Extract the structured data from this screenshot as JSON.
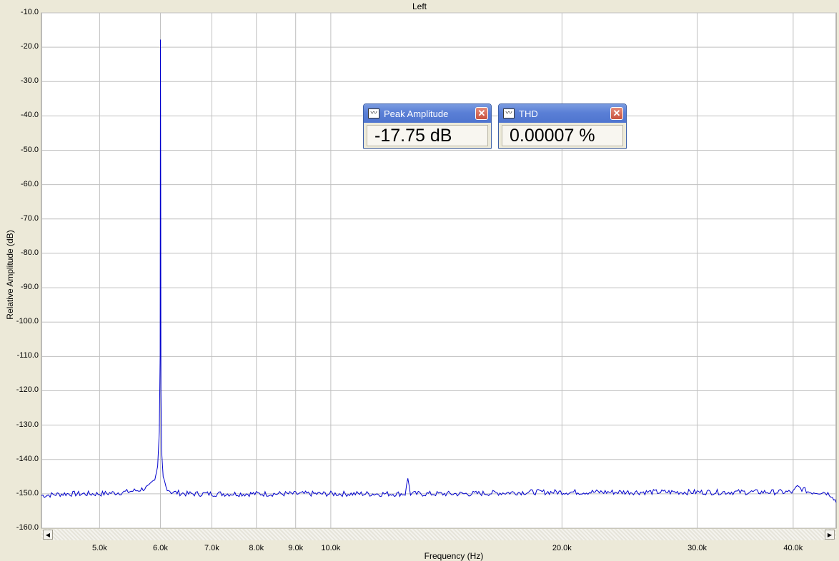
{
  "chart_data": {
    "type": "line",
    "title": "Left",
    "xlabel": "Frequency (Hz)",
    "ylabel": "Relative Amplitude (dB)",
    "x_scale": "log",
    "xlim": [
      4200,
      45500
    ],
    "ylim": [
      -160,
      -10
    ],
    "grid": true,
    "x_ticks": [
      5000,
      6000,
      7000,
      8000,
      9000,
      10000,
      20000,
      30000,
      40000
    ],
    "x_tick_labels": [
      "5.0k",
      "6.0k",
      "7.0k",
      "8.0k",
      "9.0k",
      "10.0k",
      "20.0k",
      "30.0k",
      "40.0k"
    ],
    "y_ticks": [
      -10,
      -20,
      -30,
      -40,
      -50,
      -60,
      -70,
      -80,
      -90,
      -100,
      -110,
      -120,
      -130,
      -140,
      -150,
      -160
    ],
    "y_tick_labels": [
      "-10.0",
      "-20.0",
      "-30.0",
      "-40.0",
      "-50.0",
      "-60.0",
      "-70.0",
      "-80.0",
      "-90.0",
      "-100.0",
      "-110.0",
      "-120.0",
      "-130.0",
      "-140.0",
      "-150.0",
      "-160.0"
    ],
    "series": [
      {
        "color": "#0000cc",
        "x": [
          4200,
          4500,
          5000,
          5400,
          5600,
          5800,
          5900,
          5950,
          5980,
          5995,
          6000,
          6005,
          6010,
          6020,
          6050,
          6100,
          6200,
          6500,
          7000,
          8000,
          9000,
          10000,
          11000,
          12000,
          12500,
          12600,
          12700,
          13000,
          15000,
          18000,
          20000,
          22000,
          25000,
          30000,
          35000,
          38000,
          40000,
          40500,
          42000,
          44000,
          45000,
          45500
        ],
        "y": [
          -150.5,
          -150,
          -150,
          -149.5,
          -149,
          -148,
          -146,
          -142,
          -132,
          -110,
          -17.8,
          -60,
          -120,
          -137,
          -145,
          -148,
          -149.5,
          -150,
          -150,
          -150,
          -150,
          -150,
          -150,
          -150,
          -150,
          -145.5,
          -150,
          -150,
          -150,
          -149.5,
          -149.5,
          -149.5,
          -149.5,
          -149.5,
          -149.5,
          -149.5,
          -149.5,
          -148,
          -149.5,
          -149.5,
          -150.5,
          -152.5
        ]
      }
    ]
  },
  "meters": [
    {
      "title": "Peak Amplitude",
      "value": "-17.75 dB",
      "icon": "waveform-icon",
      "close_glyph": "✕"
    },
    {
      "title": "THD",
      "value": "0.00007 %",
      "icon": "waveform-icon",
      "close_glyph": "✕"
    }
  ],
  "scrollbar": {
    "left_glyph": "◀",
    "right_glyph": "▶"
  },
  "colors": {
    "plot_bg": "#ffffff",
    "grid": "#c0c0c0",
    "series": "#0000cc",
    "window_bg": "#ece9d8"
  }
}
